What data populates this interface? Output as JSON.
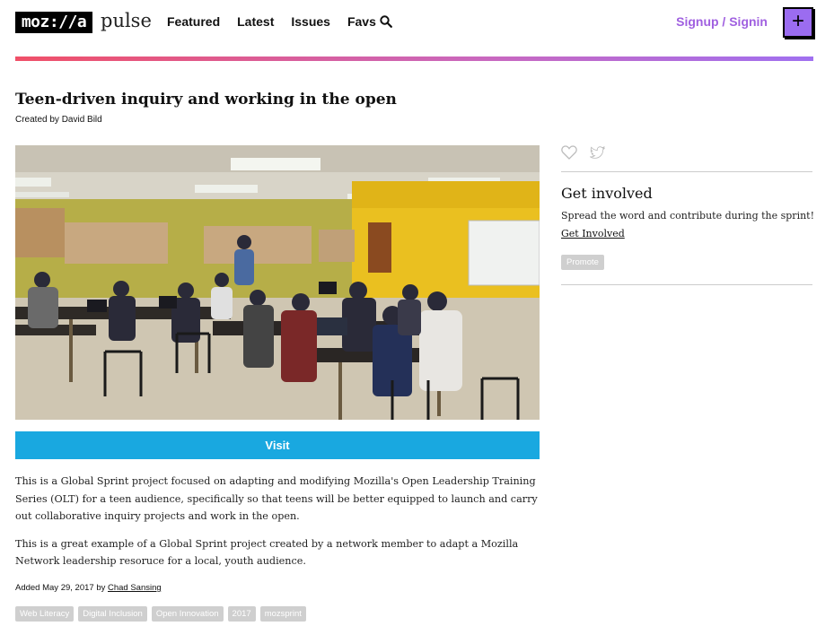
{
  "header": {
    "logo_text": "moz://a",
    "logo_suffix": "pulse",
    "nav": [
      "Featured",
      "Latest",
      "Issues",
      "Favs"
    ],
    "search_icon": "search-icon",
    "signin_label": "Signup / Signin",
    "add_label": "+",
    "accent_color": "#9b6cf0"
  },
  "project": {
    "title": "Teen-driven inquiry and working in the open",
    "created_by": "Created by David Bild",
    "visit_label": "Visit",
    "description": [
      "This is a Global Sprint project focused on adapting and modifying Mozilla's Open Leadership Training Series (OLT) for a teen audience, specifically so that teens will be better equipped to launch and carry out collaborative inquiry projects and work in the open.",
      "This is a great example of a Global Sprint project created by a network member to adapt a Mozilla Network leadership resoruce for a local, youth audience."
    ],
    "added_prefix": "Added May 29, 2017 by",
    "added_author": "Chad Sansing",
    "tags": [
      "Web Literacy",
      "Digital Inclusion",
      "Open Innovation",
      "2017",
      "mozsprint"
    ]
  },
  "sidebar": {
    "favorite_icon": "heart-icon",
    "share_icon": "twitter-icon",
    "get_involved_title": "Get involved",
    "get_involved_text": "Spread the word and contribute during the sprint!",
    "get_involved_link": "Get Involved",
    "promote_label": "Promote"
  },
  "colors": {
    "visit_button": "#19a8e0",
    "signin": "#a060e0",
    "tag_bg": "#cfcfcf"
  }
}
